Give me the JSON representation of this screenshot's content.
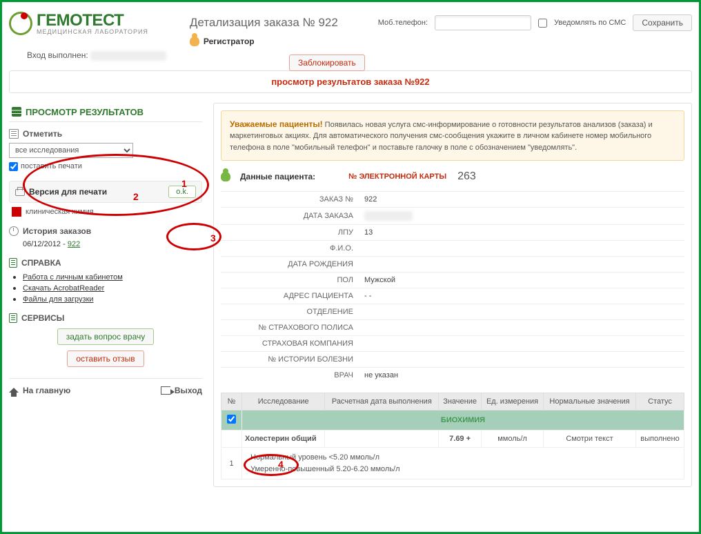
{
  "logo": {
    "brand": "ГЕМОТЕСТ",
    "sub": "МЕДИЦИНСКАЯ ЛАБОРАТОРИЯ"
  },
  "header": {
    "title": "Детализация заказа № 922",
    "phone_label": "Моб.телефон:",
    "phone_value": "",
    "notify_label": "Уведомлять по СМС",
    "save_label": "Сохранить",
    "role": "Регистратор",
    "block_label": "Заблокировать",
    "login_label": "Вход выполнен:"
  },
  "bar_title": "просмотр результатов заказа №922",
  "sidebar": {
    "panel_title": "ПРОСМОТР РЕЗУЛЬТАТОВ",
    "mark": {
      "title": "Отметить",
      "select_value": "все исследования",
      "stamp_label": "поставить печати"
    },
    "print": {
      "title": "Версия для печати",
      "ok": "o.k.",
      "chem": "клиническая химия"
    },
    "history": {
      "title": "История заказов",
      "date": "06/12/2012",
      "order": "922"
    },
    "help": {
      "title": "СПРАВКА",
      "links": [
        "Работа с личным кабинетом",
        "Скачать AcrobatReader",
        "Файлы для загрузки"
      ]
    },
    "services": {
      "title": "СЕРВИСЫ",
      "ask": "задать вопрос врачу",
      "review": "оставить отзыв"
    },
    "home": "На главную",
    "exit": "Выход"
  },
  "main": {
    "notice_head": "Уважаемые пациенты!",
    "notice_body": "Появилась новая услуга смс-информирование о готовности результатов анализов (заказа) и маркетинговых акциях. Для автоматического получения смс-сообщения укажите в личном кабинете номер мобильного телефона в поле \"мобильный телефон\" и поставьте галочку в поле с обозначением \"уведомлять\".",
    "patient_label": "Данные пациента:",
    "card_label": "№ ЭЛЕКТРОННОЙ КАРТЫ",
    "card_value": "263",
    "rows": {
      "order_no_l": "ЗАКАЗ №",
      "order_no_v": "922",
      "order_date_l": "ДАТА ЗАКАЗА",
      "order_date_v": "",
      "lpu_l": "ЛПУ",
      "lpu_v": "13",
      "fio_l": "Ф.И.О.",
      "fio_v": "",
      "dob_l": "ДАТА РОЖДЕНИЯ",
      "dob_v": "",
      "sex_l": "ПОЛ",
      "sex_v": "Мужской",
      "addr_l": "АДРЕС ПАЦИЕНТА",
      "addr_v": "- -",
      "dept_l": "ОТДЕЛЕНИЕ",
      "dept_v": "",
      "policy_l": "№ СТРАХОВОГО ПОЛИСА",
      "policy_v": "",
      "insco_l": "СТРАХОВАЯ КОМПАНИЯ",
      "insco_v": "",
      "hist_l": "№ ИСТОРИИ БОЛЕЗНИ",
      "hist_v": "",
      "doctor_l": "ВРАЧ",
      "doctor_v": "не указан"
    },
    "table": {
      "h_no": "№",
      "h_test": "Исследование",
      "h_date": "Расчетная дата выполнения",
      "h_val": "Значение",
      "h_unit": "Ед. измерения",
      "h_norm": "Нормальные значения",
      "h_status": "Статус",
      "category": "БИОХИМИЯ",
      "r1_name": "Холестерин общий",
      "r1_val": "7.69 +",
      "r1_unit": "ммоль/л",
      "r1_norm": "Смотри текст",
      "r1_status": "выполнено",
      "r1_idx": "1",
      "norm_text1": "Нормальный уровень <5.20 ммоль/л",
      "norm_text2": "Умеренно-повышенный 5.20-6.20 ммоль/л"
    }
  },
  "ann": {
    "a1": "1",
    "a2": "2",
    "a3": "3",
    "a4": "4"
  }
}
